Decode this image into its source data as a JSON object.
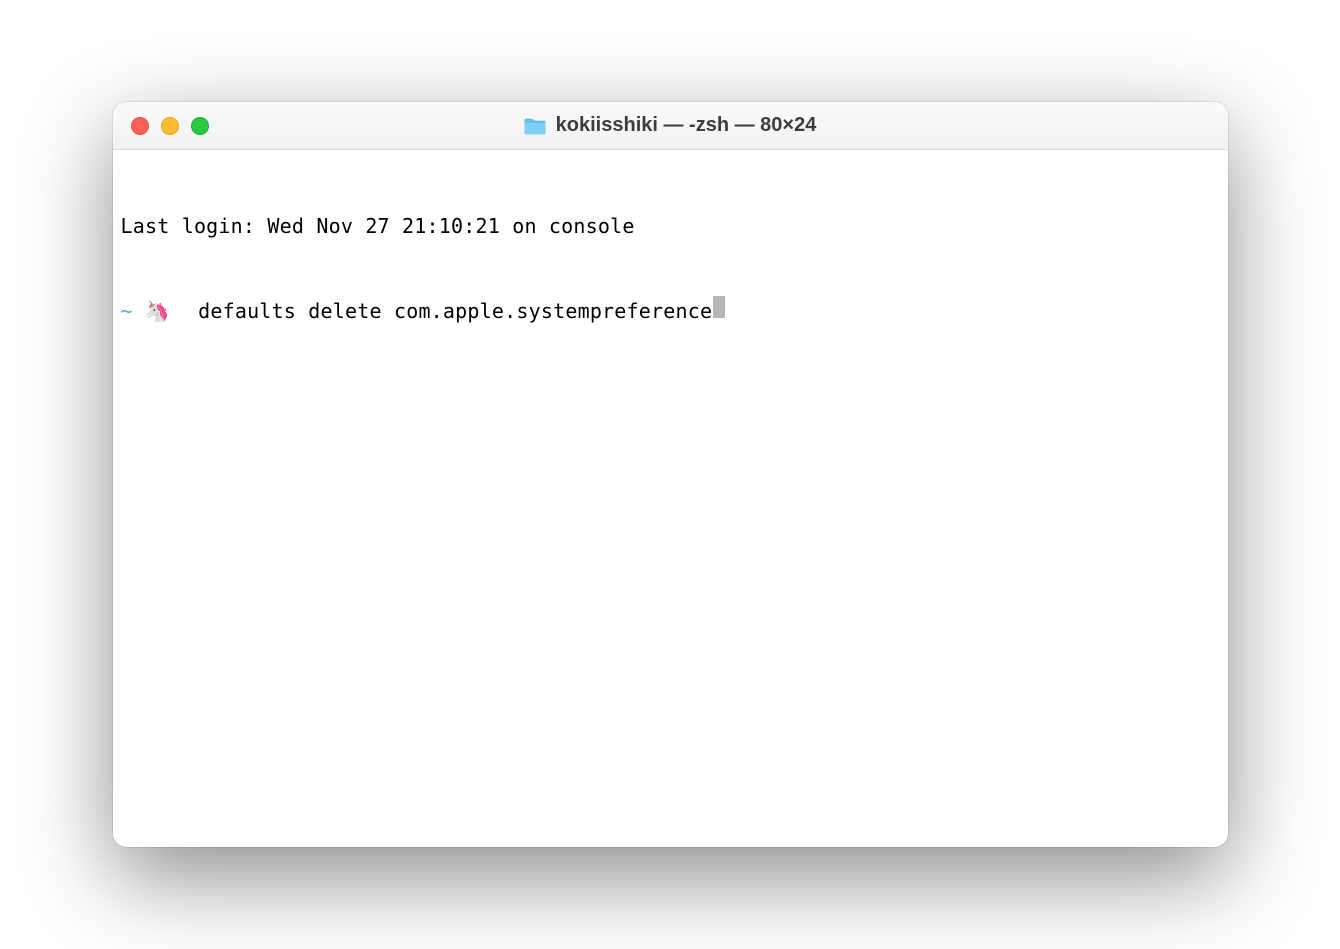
{
  "window": {
    "title": "kokiisshiki — -zsh — 80×24",
    "folder_icon": "folder-icon",
    "traffic_lights": {
      "close": "#ff5f57",
      "minimize": "#febc2e",
      "zoom": "#28c840"
    }
  },
  "terminal": {
    "last_login_line": "Last login: Wed Nov 27 21:10:21 on console",
    "prompt": {
      "cwd_symbol": "~",
      "emoji": "🦄",
      "command": " defaults delete com.apple.systempreference"
    }
  }
}
